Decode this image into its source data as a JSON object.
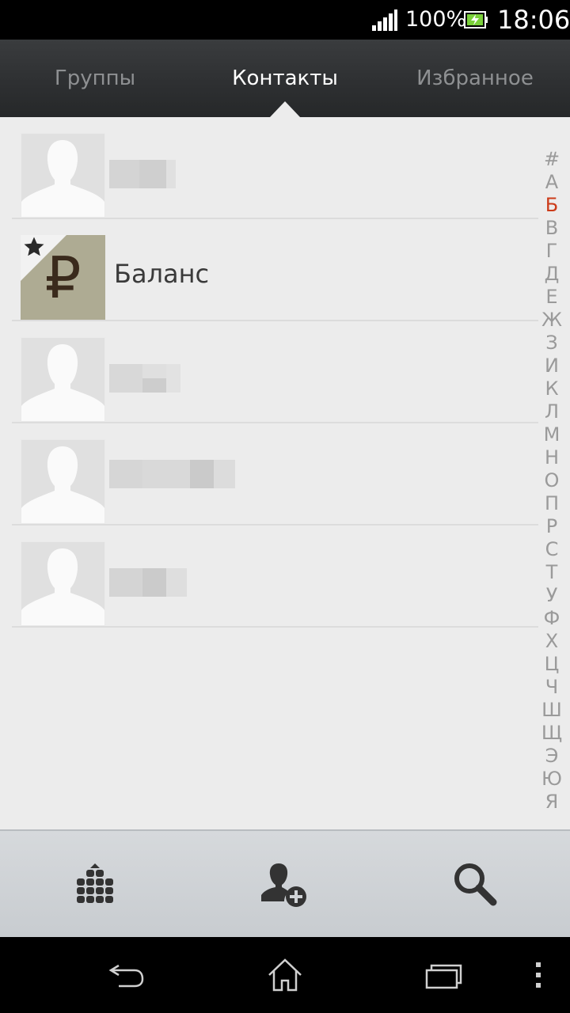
{
  "status_bar": {
    "battery_percent": "100%",
    "time": "18:06",
    "icons": [
      "signal-icon",
      "battery-charging-icon"
    ]
  },
  "tabs": [
    {
      "label": "Группы",
      "active": false
    },
    {
      "label": "Контакты",
      "active": true
    },
    {
      "label": "Избранное",
      "active": false
    }
  ],
  "contacts": [
    {
      "name": "",
      "avatar": "default-avatar",
      "name_obscured": true
    },
    {
      "name": "Баланс",
      "avatar": "ruble-icon",
      "starred": true
    },
    {
      "name": "",
      "avatar": "default-avatar",
      "name_obscured": true
    },
    {
      "name": "",
      "avatar": "default-avatar",
      "name_obscured": true
    },
    {
      "name": "",
      "avatar": "default-avatar",
      "name_obscured": true
    }
  ],
  "avatar_glyph": "₽",
  "alphabet_index": {
    "letters": [
      "#",
      "А",
      "Б",
      "В",
      "Г",
      "Д",
      "Е",
      "Ж",
      "З",
      "И",
      "К",
      "Л",
      "М",
      "Н",
      "О",
      "П",
      "Р",
      "С",
      "Т",
      "У",
      "Ф",
      "Х",
      "Ц",
      "Ч",
      "Ш",
      "Щ",
      "Э",
      "Ю",
      "Я"
    ],
    "active": "Б"
  },
  "action_bar": {
    "buttons": [
      "dialpad-icon",
      "add-contact-icon",
      "search-icon"
    ]
  },
  "nav_bar": {
    "buttons": [
      "back-icon",
      "home-icon",
      "recent-apps-icon",
      "overflow-menu-icon"
    ]
  },
  "colors": {
    "accent_active_letter": "#cc3c1a",
    "tab_active": "#ffffff",
    "tab_inactive": "#8e9092"
  }
}
